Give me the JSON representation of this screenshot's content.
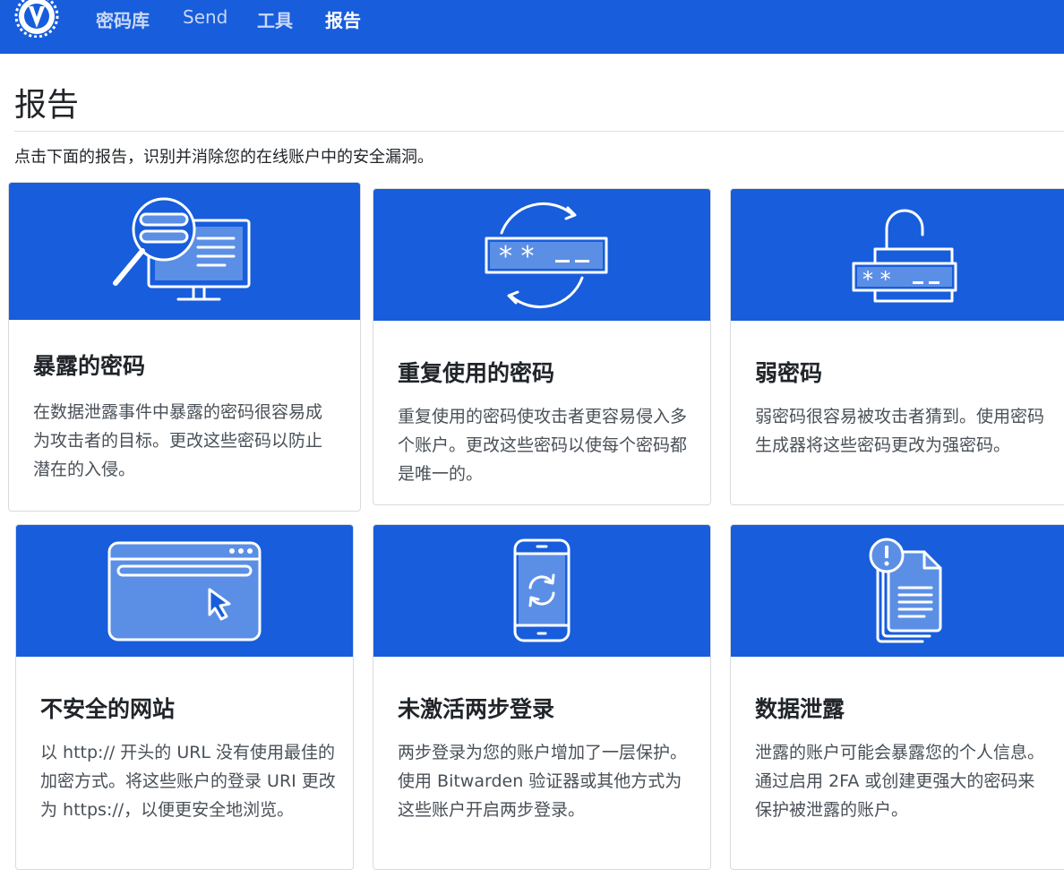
{
  "nav": {
    "items": [
      {
        "label": "密码库"
      },
      {
        "label": "Send"
      },
      {
        "label": "工具"
      },
      {
        "label": "报告"
      }
    ]
  },
  "page": {
    "title": "报告",
    "intro": "点击下面的报告，识别并消除您的在线账户中的安全漏洞。"
  },
  "cards": [
    {
      "title": "暴露的密码",
      "description": "在数据泄露事件中暴露的密码很容易成为攻击者的目标。更改这些密码以防止潜在的入侵。",
      "icon": "magnifier-monitor-icon"
    },
    {
      "title": "重复使用的密码",
      "description": "重复使用的密码使攻击者更容易侵入多个账户。更改这些密码以使每个密码都是唯一的。",
      "icon": "recycle-password-icon"
    },
    {
      "title": "弱密码",
      "description": "弱密码很容易被攻击者猜到。使用密码生成器将这些密码更改为强密码。",
      "icon": "padlock-password-icon"
    },
    {
      "title": "不安全的网站",
      "description": "以 http:// 开头的 URL 没有使用最佳的加密方式。将这些账户的登录 URI 更改为 https://，以便更安全地浏览。",
      "icon": "browser-cursor-icon"
    },
    {
      "title": "未激活两步登录",
      "description": "两步登录为您的账户增加了一层保护。使用 Bitwarden 验证器或其他方式为这些账户开启两步登录。",
      "icon": "phone-sync-icon"
    },
    {
      "title": "数据泄露",
      "description": "泄露的账户可能会暴露您的个人信息。通过启用 2FA 或创建更强大的密码来保护被泄露的账户。",
      "icon": "alert-documents-icon"
    }
  ],
  "colors": {
    "brand": "#175ddc",
    "text": "#212529",
    "muted": "#495057"
  }
}
